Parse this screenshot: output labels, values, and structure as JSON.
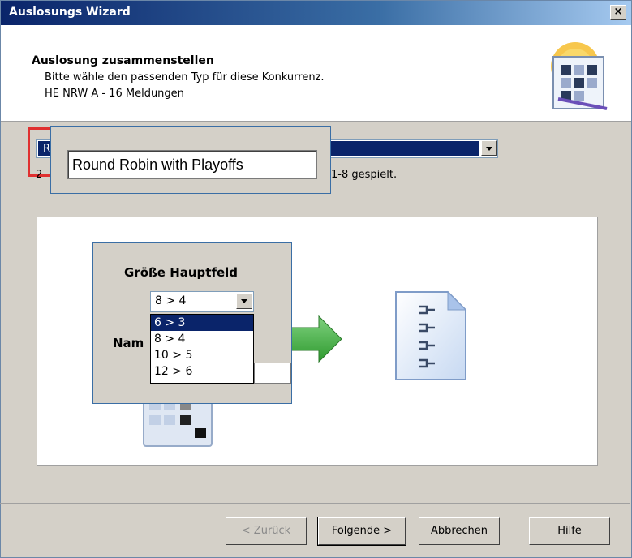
{
  "window": {
    "title": "Auslosungs Wizard",
    "close_glyph": "×"
  },
  "header": {
    "title": "Auslosung zusammenstellen",
    "subtitle": "Bitte wähle den passenden Typ für diese Konkurrenz.",
    "info": "HE NRW A - 16 Meldungen",
    "icon": "draw-wizard-icon"
  },
  "draw_type": {
    "visible_prefix": "R",
    "selected": "Round Robin with Playoffs",
    "description_prefix": "2",
    "description_suffix": "1-8 gespielt."
  },
  "zoom_main": {
    "value": "Round Robin with Playoffs"
  },
  "zoom_panel": {
    "label": "Größe Hauptfeld",
    "name_label": "Nam",
    "selected": "8 > 4",
    "options": [
      "6 > 3",
      "8 > 4",
      "10 > 5",
      "12 > 6"
    ],
    "highlighted_index": 0
  },
  "buttons": {
    "back": "< Zurück",
    "next": "Folgende >",
    "cancel": "Abbrechen",
    "help": "Hilfe"
  },
  "colors": {
    "selection": "#0a246a",
    "highlight_border": "#e03030",
    "arrow": "#3aa83a"
  }
}
